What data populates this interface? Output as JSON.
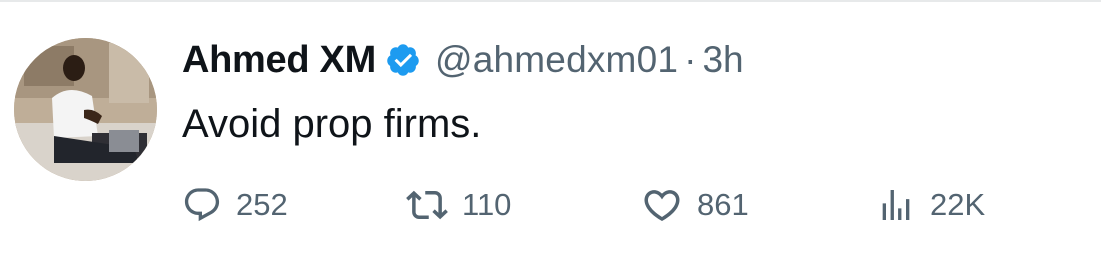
{
  "tweet": {
    "author": {
      "display_name": "Ahmed XM",
      "handle": "@ahmedxm01",
      "verified": true,
      "avatar_icon": "profile-photo"
    },
    "separator": "·",
    "time_ago": "3h",
    "text": "Avoid prop firms.",
    "actions": {
      "replies": {
        "icon": "reply-icon",
        "count": "252"
      },
      "retweets": {
        "icon": "retweet-icon",
        "count": "110"
      },
      "likes": {
        "icon": "heart-icon",
        "count": "861"
      },
      "views": {
        "icon": "views-icon",
        "count": "22K"
      }
    }
  },
  "colors": {
    "text_primary": "#0f1419",
    "text_secondary": "#536471",
    "verified_badge": "#1d9bf0",
    "divider": "#e7e9ea"
  }
}
